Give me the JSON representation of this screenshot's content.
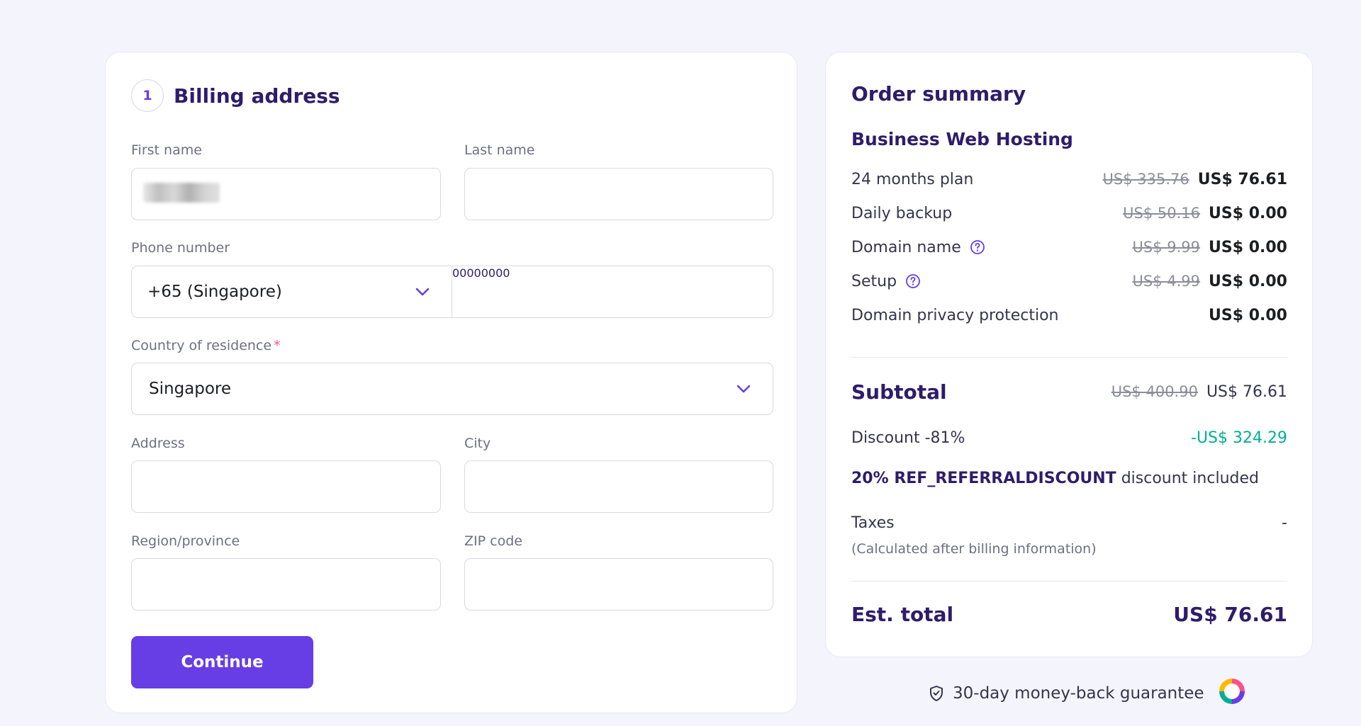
{
  "billing": {
    "step_number": "1",
    "title": "Billing address",
    "first_name_label": "First name",
    "last_name_label": "Last name",
    "phone_label": "Phone number",
    "phone_code_value": "+65 (Singapore)",
    "phone_placeholder": "00000000",
    "country_label": "Country of residence",
    "country_required_mark": "*",
    "country_value": "Singapore",
    "address_label": "Address",
    "city_label": "City",
    "region_label": "Region/province",
    "zip_label": "ZIP code",
    "continue_label": "Continue"
  },
  "summary": {
    "title": "Order summary",
    "plan_name": "Business Web Hosting",
    "lines": [
      {
        "label": "24 months plan",
        "old_price": "US$ 335.76",
        "price": "US$ 76.61"
      },
      {
        "label": "Daily backup",
        "old_price": "US$ 50.16",
        "price": "US$ 0.00"
      },
      {
        "label": "Domain name",
        "old_price": "US$ 9.99",
        "price": "US$ 0.00"
      },
      {
        "label": "Setup",
        "old_price": "US$ 4.99",
        "price": "US$ 0.00"
      },
      {
        "label": "Domain privacy protection",
        "price": "US$ 0.00"
      }
    ],
    "subtotal_label": "Subtotal",
    "subtotal_old": "US$ 400.90",
    "subtotal_value": "US$ 76.61",
    "discount_label": "Discount -81%",
    "discount_value": "-US$ 324.29",
    "ref_code": "20% REF_REFERRALDISCOUNT",
    "ref_suffix": "discount included",
    "taxes_label": "Taxes",
    "taxes_value": "-",
    "taxes_note": "(Calculated after billing information)",
    "total_label": "Est. total",
    "total_value": "US$ 76.61"
  },
  "footer": {
    "guarantee": "30-day money-back guarantee"
  },
  "icons": {
    "dropdown": "chevron-down-icon",
    "help": "question-circle-icon",
    "guarantee": "shield-check-icon"
  },
  "colors": {
    "primary": "#673de6",
    "heading": "#2f1c6a",
    "discount": "#00b090",
    "background": "#f4f5fc"
  }
}
